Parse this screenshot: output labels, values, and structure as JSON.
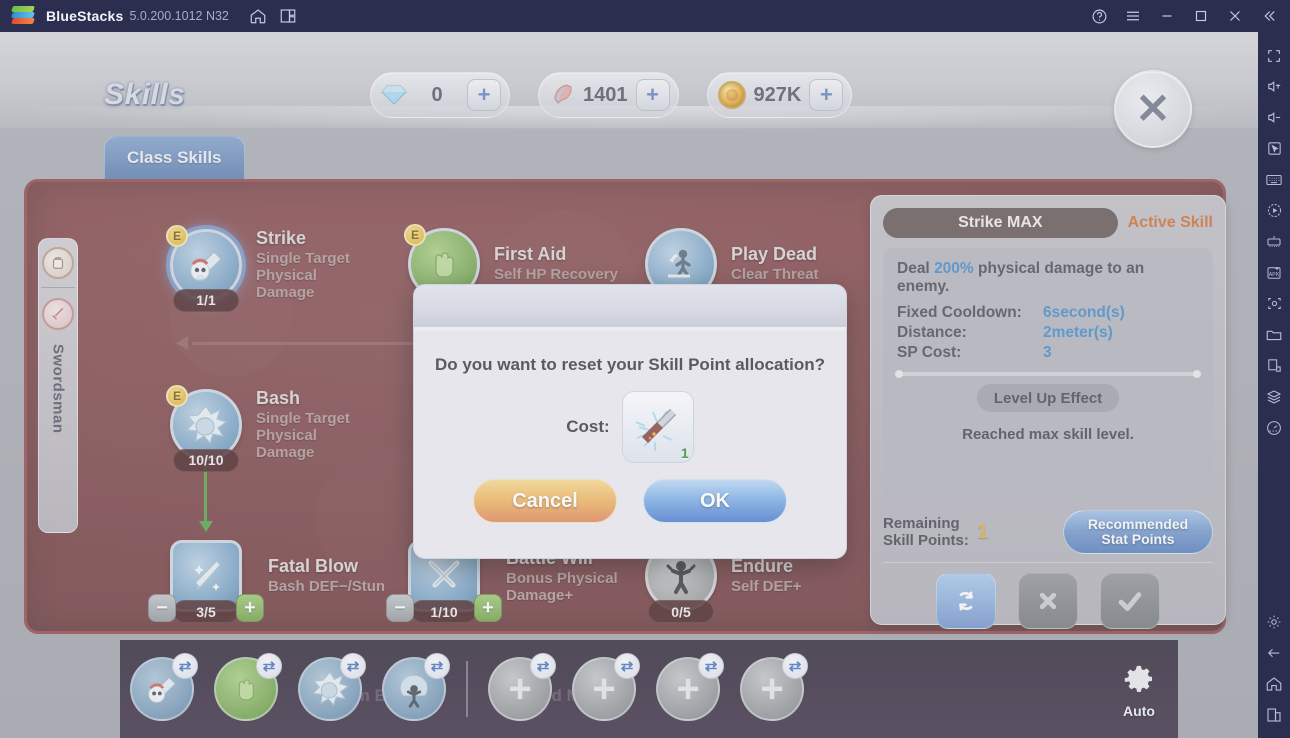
{
  "titlebar": {
    "app_name": "BlueStacks",
    "version": "5.0.200.1012 N32",
    "icons": [
      "home-icon",
      "multi-instance-icon"
    ],
    "right_icons": [
      "help-icon",
      "menu-icon",
      "minimize-icon",
      "maximize-icon",
      "close-icon",
      "collapse-icon"
    ]
  },
  "sidebar_right": {
    "items": [
      "fullscreen-icon",
      "volume-up-icon",
      "volume-down-icon",
      "pointer-icon",
      "keyboard-icon",
      "macro-record-icon",
      "game-controls-icon",
      "install-apk-icon",
      "screenshot-icon",
      "media-folder-icon",
      "copy-paste-icon",
      "layers-icon",
      "performance-icon"
    ],
    "bottom_items": [
      "settings-icon",
      "back-icon",
      "home-icon",
      "recents-icon"
    ]
  },
  "game": {
    "page_title": "Skills",
    "close_label": "✕",
    "currencies": [
      {
        "icon": "diamond-icon",
        "value": "0",
        "add_label": "+"
      },
      {
        "icon": "feather-icon",
        "value": "1401",
        "add_label": "+"
      },
      {
        "icon": "gold-coin-icon",
        "value": "927K",
        "add_label": "+"
      }
    ],
    "tabs": [
      {
        "label": "Class Skills",
        "active": true
      }
    ],
    "class_rail": {
      "name": "Swordsman",
      "icons": [
        "novice-class-icon",
        "swordsman-class-icon"
      ]
    },
    "skills": [
      {
        "name": "Strike",
        "desc": "Single Target\nPhysical\nDamage",
        "level": "1/1",
        "badge": "E",
        "selected": true,
        "icon": "skull-sword-icon"
      },
      {
        "name": "First Aid",
        "desc": "Self HP Recovery",
        "level": "",
        "badge": "E",
        "selected": false,
        "icon": "hand-heal-icon"
      },
      {
        "name": "Play Dead",
        "desc": "Clear Threat",
        "level": "",
        "badge": "",
        "selected": false,
        "icon": "play-dead-icon"
      },
      {
        "name": "Bash",
        "desc": "Single Target\nPhysical\nDamage",
        "level": "10/10",
        "badge": "E",
        "selected": false,
        "icon": "bash-impact-icon"
      },
      {
        "name": "Fatal Blow",
        "desc": "Bash DEF−/Stun",
        "level": "3/5",
        "badge": "",
        "selected": false,
        "icon": "sword-slash-icon",
        "minus": "−",
        "plus": "+"
      },
      {
        "name": "Battle Will",
        "desc": "Bonus Physical\nDamage+",
        "level": "1/10",
        "badge": "",
        "selected": false,
        "icon": "crossed-swords-icon",
        "minus": "−",
        "plus": "+"
      },
      {
        "name": "Endure",
        "desc": "Self DEF+",
        "level": "0/5",
        "badge": "",
        "selected": false,
        "icon": "endure-icon"
      }
    ],
    "detail": {
      "title": "Strike MAX",
      "type": "Active Skill",
      "description_prefix": "Deal ",
      "description_value": "200%",
      "description_suffix": " physical damage to an enemy.",
      "stats": [
        {
          "key": "Fixed Cooldown:",
          "value": "6second(s)"
        },
        {
          "key": "Distance:",
          "value": "2meter(s)"
        },
        {
          "key": "SP Cost:",
          "value": "3"
        }
      ],
      "levelup_label": "Level Up Effect",
      "levelup_text": "Reached max skill level.",
      "remaining_label": "Remaining\nSkill Points:",
      "remaining_value": "1",
      "recommended_label": "Recommended\nStat Points",
      "actions": [
        "reset-icon",
        "cancel-icon",
        "confirm-icon"
      ]
    },
    "quickbar": {
      "slots": [
        {
          "icon": "skull-sword-icon",
          "filled": true,
          "swap": "swap-icon"
        },
        {
          "icon": "hand-heal-icon",
          "filled": true,
          "swap": "swap-icon"
        },
        {
          "icon": "bash-impact-icon",
          "filled": true,
          "swap": "swap-icon"
        },
        {
          "icon": "sword-mastery-icon",
          "filled": true,
          "swap": "swap-icon"
        },
        {
          "icon": "add-icon",
          "filled": false,
          "swap": "swap-icon",
          "plus": "+"
        },
        {
          "icon": "add-icon",
          "filled": false,
          "swap": "swap-icon",
          "plus": "+"
        },
        {
          "icon": "add-icon",
          "filled": false,
          "swap": "swap-icon",
          "plus": "+"
        },
        {
          "icon": "add-icon",
          "filled": false,
          "swap": "swap-icon",
          "plus": "+"
        }
      ],
      "ghost_labels": [
        "Magnum Break",
        "Sword Mastery"
      ],
      "auto_label": "Auto"
    }
  },
  "modal": {
    "question": "Do you want to reset your Skill Point allocation?",
    "cost_label": "Cost:",
    "cost_item_icon": "reset-rod-item-icon",
    "cost_quantity": "1",
    "cancel_label": "Cancel",
    "ok_label": "OK"
  },
  "colors": {
    "titlebar_bg": "#2b2e4f",
    "board_red": "#77383b",
    "accent_blue": "#3a87c8",
    "accent_orange": "#cf6a2a",
    "ok_blue": "#4f7fd0",
    "cancel_orange": "#e08a5c"
  }
}
